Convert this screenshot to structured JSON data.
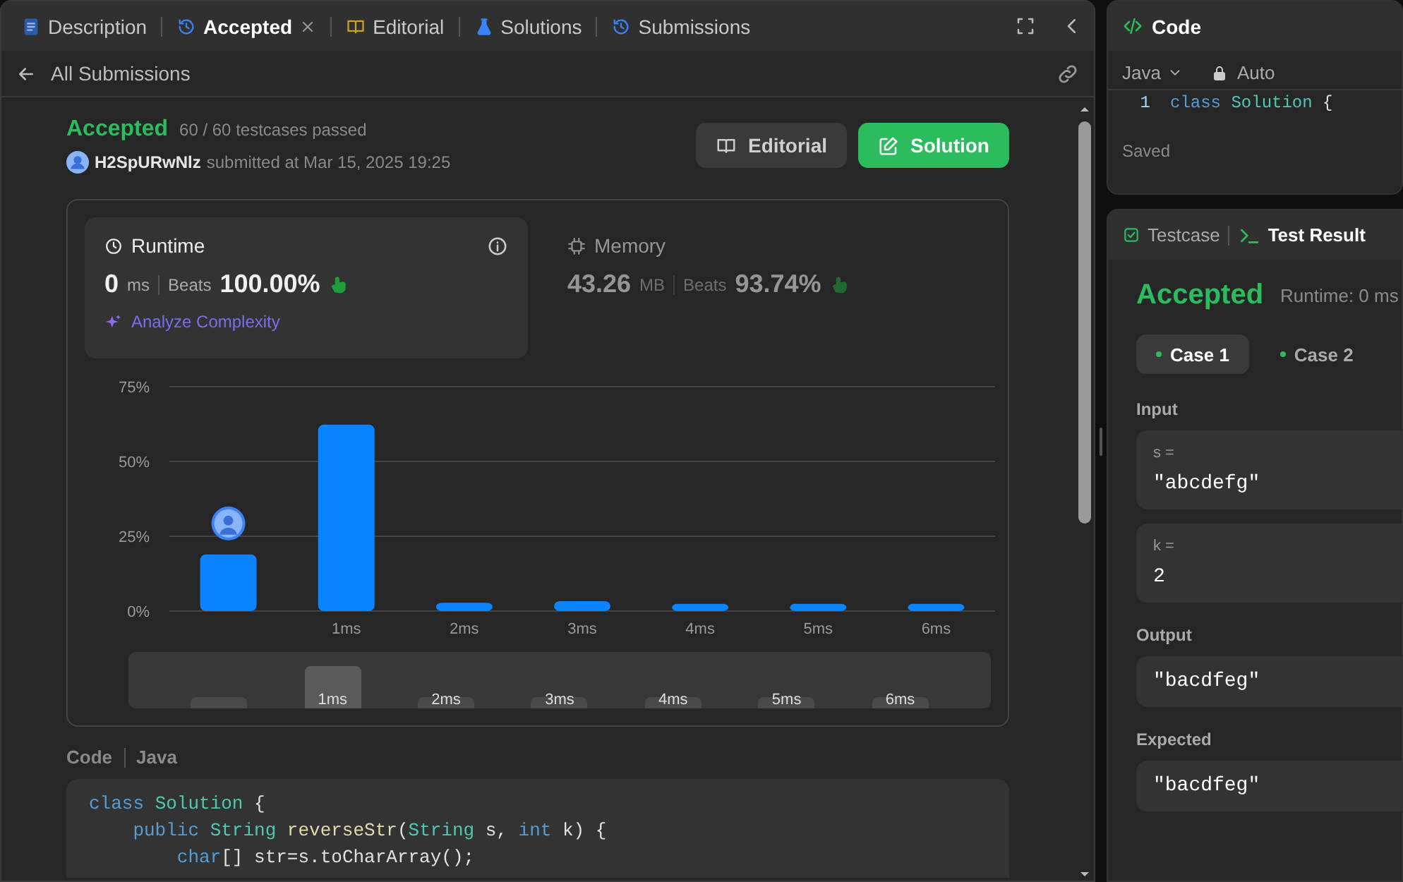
{
  "tabs": [
    {
      "label": "Description",
      "kind": "description",
      "selected": false,
      "closable": false
    },
    {
      "label": "Accepted",
      "kind": "submission",
      "selected": true,
      "closable": true
    },
    {
      "label": "Editorial",
      "kind": "editorial",
      "selected": false,
      "closable": false
    },
    {
      "label": "Solutions",
      "kind": "solutions",
      "selected": false,
      "closable": false
    },
    {
      "label": "Submissions",
      "kind": "submission",
      "selected": false,
      "closable": false
    }
  ],
  "back_link": "All Submissions",
  "result": {
    "status": "Accepted",
    "passed": "60 / 60 testcases passed",
    "user": "H2SpURwNlz",
    "submitted": "submitted at Mar 15, 2025 19:25"
  },
  "actions": [
    {
      "label": "Editorial",
      "kind": "secondary"
    },
    {
      "label": "Solution",
      "kind": "primary"
    }
  ],
  "stats": [
    {
      "title": "Runtime",
      "kind": "runtime",
      "selected": true,
      "value": "0",
      "unit": "ms",
      "beats_label": "Beats",
      "beats": "100.00%",
      "link": "Analyze Complexity"
    },
    {
      "title": "Memory",
      "kind": "memory",
      "selected": false,
      "value": "43.26",
      "unit": "MB",
      "beats_label": "Beats",
      "beats": "93.74%"
    }
  ],
  "chart_data": {
    "type": "bar",
    "categories": [
      null,
      "1ms",
      "2ms",
      "3ms",
      "4ms",
      "5ms",
      "6ms"
    ],
    "series": [
      {
        "color": "#0a84ff",
        "values": [
          18.9,
          62.3,
          2.8,
          3.3,
          2.4,
          2.4,
          2.4
        ]
      }
    ],
    "ylim": [
      0,
      75
    ],
    "yticks": [
      {
        "value": 0,
        "label": "0%"
      },
      {
        "value": 25,
        "label": "25%"
      },
      {
        "value": 50,
        "label": "50%"
      },
      {
        "value": 75,
        "label": "75%"
      }
    ]
  },
  "brush": [
    {
      "selected": false
    },
    {
      "label": "1ms",
      "selected": true
    },
    {
      "label": "2ms",
      "selected": false
    },
    {
      "label": "3ms",
      "selected": false
    },
    {
      "label": "4ms",
      "selected": false
    },
    {
      "label": "5ms",
      "selected": false
    },
    {
      "label": "6ms",
      "selected": false
    }
  ],
  "code_section": {
    "title": "Code",
    "language": "Java",
    "lines": [
      [
        {
          "kind": "keyword",
          "text": "class"
        },
        {
          "kind": "type",
          "text": " Solution"
        },
        {
          "kind": "plain",
          "text": " {"
        }
      ],
      [
        {
          "kind": "keyword",
          "text": "    public"
        },
        {
          "kind": "type",
          "text": " String"
        },
        {
          "kind": "func",
          "text": " reverseStr"
        },
        {
          "kind": "plain",
          "text": "("
        },
        {
          "kind": "type",
          "text": "String"
        },
        {
          "kind": "plain",
          "text": " s, "
        },
        {
          "kind": "keyword",
          "text": "int"
        },
        {
          "kind": "plain",
          "text": " k) {"
        }
      ],
      [
        {
          "kind": "keyword",
          "text": "        char"
        },
        {
          "kind": "plain",
          "text": "[] str=s.toCharArray();"
        }
      ]
    ]
  },
  "editor": {
    "title": "Code",
    "language": "Java",
    "mode": "Auto",
    "status": "Saved",
    "lines": [
      {
        "number": "1",
        "tokens": [
          {
            "kind": "keyword",
            "text": "class"
          },
          {
            "kind": "type",
            "text": " Solution"
          },
          {
            "kind": "plain",
            "text": " {"
          }
        ]
      }
    ]
  },
  "test_panel": {
    "tabs": [
      {
        "label": "Testcase",
        "kind": "testcase",
        "selected": false
      },
      {
        "label": "Test Result",
        "kind": "result",
        "selected": true
      }
    ],
    "status": "Accepted",
    "runtime": "Runtime: 0 ms",
    "cases": [
      {
        "label": "Case 1",
        "selected": true
      },
      {
        "label": "Case 2",
        "selected": false
      }
    ],
    "input_label": "Input",
    "inputs": [
      {
        "name": "s =",
        "value": "\"abcdefg\""
      },
      {
        "name": "k =",
        "value": "2"
      }
    ],
    "output_label": "Output",
    "output": "\"bacdfeg\"",
    "expected_label": "Expected",
    "expected": "\"bacdfeg\""
  }
}
